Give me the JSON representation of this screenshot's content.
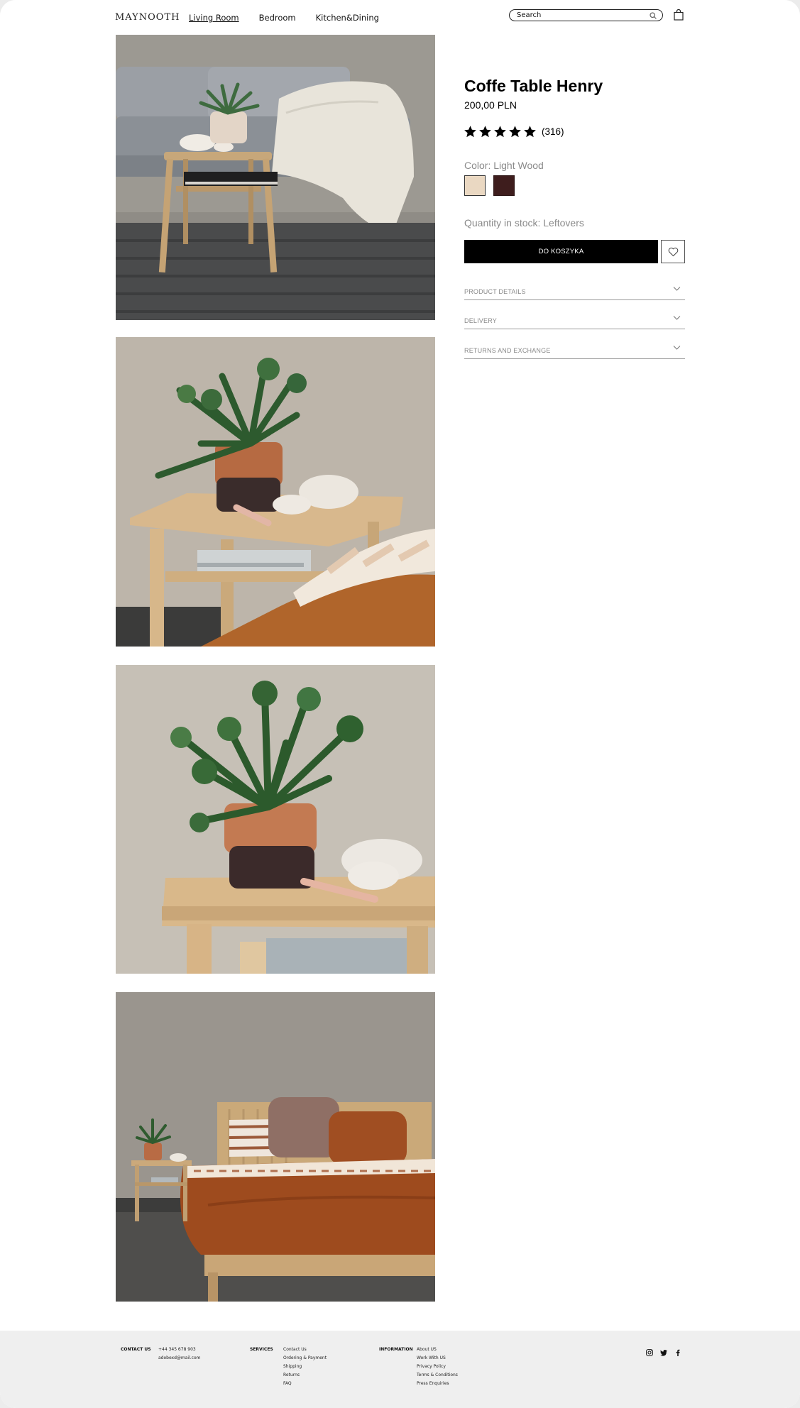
{
  "header": {
    "logo": "MAYNOOTH",
    "nav": [
      "Living Room",
      "Bedroom",
      "Kitchen&Dining"
    ],
    "active_nav": "Living Room",
    "search_placeholder": "Search",
    "icons": [
      "search-icon",
      "shopping-bag-icon"
    ]
  },
  "product": {
    "title": "Coffe Table Henry",
    "price": "200,00 PLN",
    "rating": 5,
    "review_count": "(316)",
    "color_label": "Color: Light Wood",
    "swatches": [
      {
        "name": "Light Wood",
        "color": "#ead8c2",
        "selected": true
      },
      {
        "name": "Dark Wood",
        "color": "#3e1d1d",
        "selected": false
      }
    ],
    "stock_label": "Quantity in stock: Leftovers",
    "add_to_cart": "DO KOSZYKA",
    "accordion": [
      "PRODUCT DETAILS",
      "DELIVERY",
      "RETURNS AND EXCHANGE"
    ]
  },
  "footer": {
    "contact_heading": "CONTACT US",
    "contact": [
      "+44 345 678 903",
      "adobexd@mail.com"
    ],
    "services_heading": "SERVICES",
    "services": [
      "Contact Us",
      "Ordering & Payment",
      "Shipping",
      "Returns",
      "FAQ"
    ],
    "information_heading": "INFORMATION",
    "information": [
      "About US",
      "Work With US",
      "Privacy Policy",
      "Terms & Conditions",
      "Press Enquiries"
    ],
    "social_icons": [
      "instagram-icon",
      "twitter-icon",
      "facebook-icon"
    ]
  },
  "colors": {
    "accent": "#000000",
    "muted_text": "#8a8a8a",
    "footer_bg": "#efefef"
  }
}
